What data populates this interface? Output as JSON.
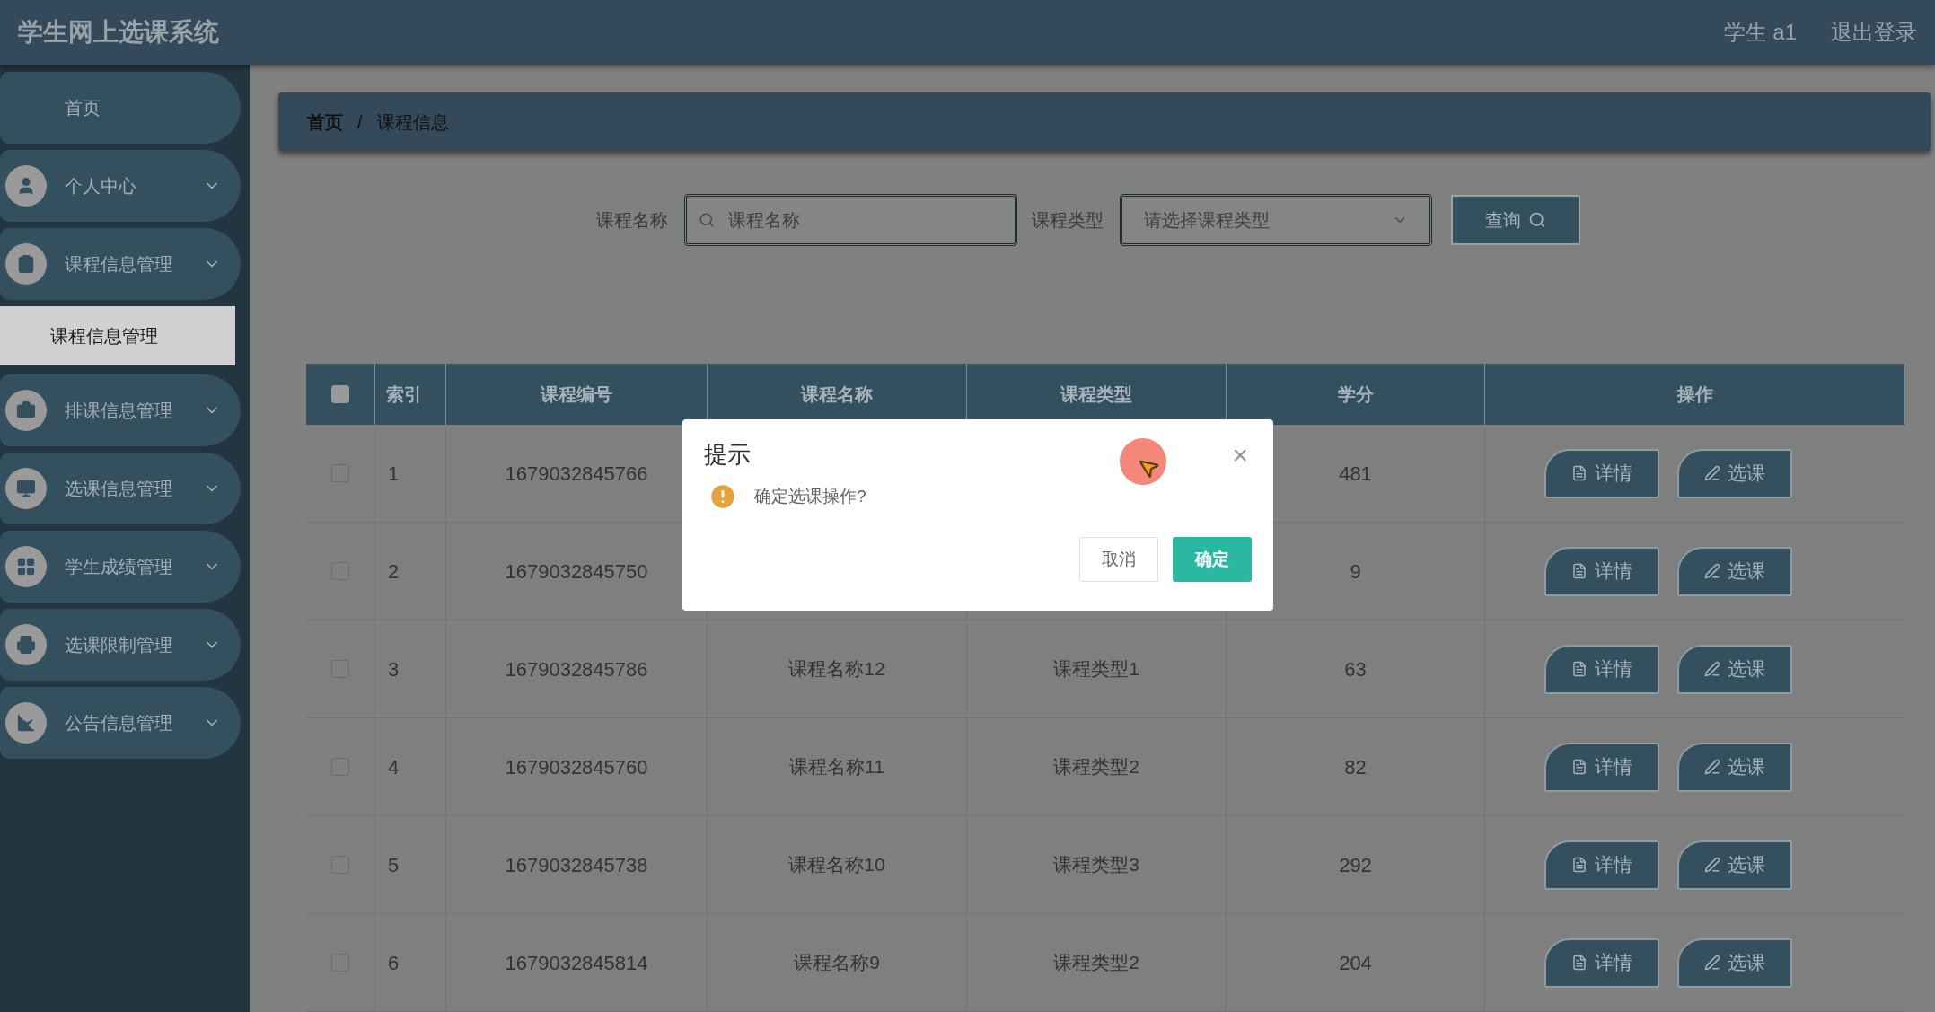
{
  "header": {
    "title": "学生网上选课系统",
    "user": "学生 a1",
    "logout": "退出登录"
  },
  "sidebar": {
    "items": [
      {
        "label": "首页",
        "kind": "link"
      },
      {
        "label": "个人中心",
        "kind": "menu"
      },
      {
        "label": "课程信息管理",
        "kind": "menu",
        "children": [
          {
            "label": "课程信息管理",
            "selected": true
          }
        ]
      },
      {
        "label": "排课信息管理",
        "kind": "menu"
      },
      {
        "label": "选课信息管理",
        "kind": "menu"
      },
      {
        "label": "学生成绩管理",
        "kind": "menu"
      },
      {
        "label": "选课限制管理",
        "kind": "menu"
      },
      {
        "label": "公告信息管理",
        "kind": "menu"
      }
    ]
  },
  "breadcrumb": [
    "首页",
    "/",
    "课程信息"
  ],
  "search": {
    "name_label": "课程名称",
    "name_placeholder": "课程名称",
    "type_label": "课程类型",
    "type_placeholder": "请选择课程类型",
    "button": "查询"
  },
  "table": {
    "header_checked": false,
    "columns": [
      "索引",
      "课程编号",
      "课程名称",
      "课程类型",
      "学分",
      "操作"
    ],
    "rows": [
      {
        "checked": false,
        "index": "1",
        "code": "1679032845766",
        "credit": "481",
        "actions": [
          "详情",
          "选课"
        ]
      },
      {
        "checked": false,
        "index": "2",
        "code": "1679032845750",
        "credit": "9",
        "actions": [
          "详情",
          "选课"
        ]
      },
      {
        "checked": false,
        "index": "3",
        "code": "1679032845786",
        "name": "课程名称12",
        "type": "课程类型1",
        "credit": "63",
        "actions": [
          "详情",
          "选课"
        ]
      },
      {
        "checked": false,
        "index": "4",
        "code": "1679032845760",
        "name": "课程名称11",
        "type": "课程类型2",
        "credit": "82",
        "actions": [
          "详情",
          "选课"
        ]
      },
      {
        "checked": false,
        "index": "5",
        "code": "1679032845738",
        "name": "课程名称10",
        "type": "课程类型3",
        "credit": "292",
        "actions": [
          "详情",
          "选课"
        ]
      },
      {
        "checked": false,
        "index": "6",
        "code": "1679032845814",
        "name": "课程名称9",
        "type": "课程类型2",
        "credit": "204",
        "actions": [
          "详情",
          "选课"
        ]
      }
    ]
  },
  "dialog": {
    "title": "提示",
    "close": "×",
    "message": "确定选课操作?",
    "cancel": "取消",
    "confirm": "确定"
  }
}
